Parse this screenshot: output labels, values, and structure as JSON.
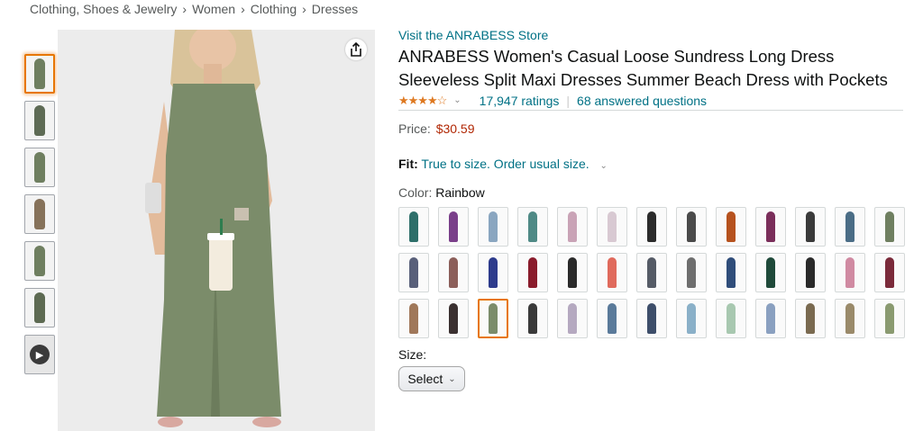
{
  "breadcrumb": [
    "Clothing, Shoes & Jewelry",
    "Women",
    "Clothing",
    "Dresses"
  ],
  "breadcrumb_separator": "›",
  "share_icon": "share-icon",
  "product": {
    "store_link": "Visit the ANRABESS Store",
    "title": "ANRABESS Women's Casual Loose Sundress Long Dress Sleeveless Split Maxi Dresses Summer Beach Dress with Pockets",
    "stars": "★★★★☆",
    "rating_value": 4.5,
    "ratings": "17,947 ratings",
    "answered": "68 answered questions",
    "price_label": "Price:",
    "price": "$30.59",
    "fit_label": "Fit:",
    "fit_value": "True to size. Order usual size.",
    "color_label": "Color:",
    "color_value": "Rainbow",
    "size_label": "Size:",
    "size_select": "Select"
  },
  "colors": {
    "accent": "#e77600",
    "link": "#007185",
    "price": "#b12704",
    "star": "#de7921",
    "main_dress": "#7b8c6a"
  },
  "thumbnails": [
    {
      "color": "#6f7f60",
      "selected": true
    },
    {
      "color": "#5e6b55",
      "selected": false
    },
    {
      "color": "#6f7f60",
      "selected": false
    },
    {
      "color": "#86725a",
      "selected": false
    },
    {
      "color": "#6f7f60",
      "selected": false
    },
    {
      "color": "#5d6a52",
      "selected": false
    },
    {
      "video": true
    }
  ],
  "swatches": [
    "#2e6f6a",
    "#7a3f8a",
    "#8aa6c0",
    "#4f8a86",
    "#c9a3b6",
    "#d8c9d2",
    "#2b2b2b",
    "#4a4a4a",
    "#b6521e",
    "#7a2e5a",
    "#3a3a3a",
    "#4b6d86",
    "#6f7f60",
    "#59607a",
    "#8c5f5a",
    "#2d3b8c",
    "#8a1c2c",
    "#2a2a2a",
    "#e06a5c",
    "#555b66",
    "#6e6e6e",
    "#2f4d7a",
    "#1f4a3a",
    "#2a2a2a",
    "#d08aa2",
    "#7a2a3a",
    "#a0785a",
    "#3a3030",
    "#7b8c6a",
    "#3a3a3a",
    "#b5a9c0",
    "#5a7a9a",
    "#3d4e6a",
    "#8ab0c8",
    "#a8c8b0",
    "#8aa0c0",
    "#7a6a50",
    "#9a8a6a",
    "#8a9a70"
  ],
  "selected_swatch": 28
}
